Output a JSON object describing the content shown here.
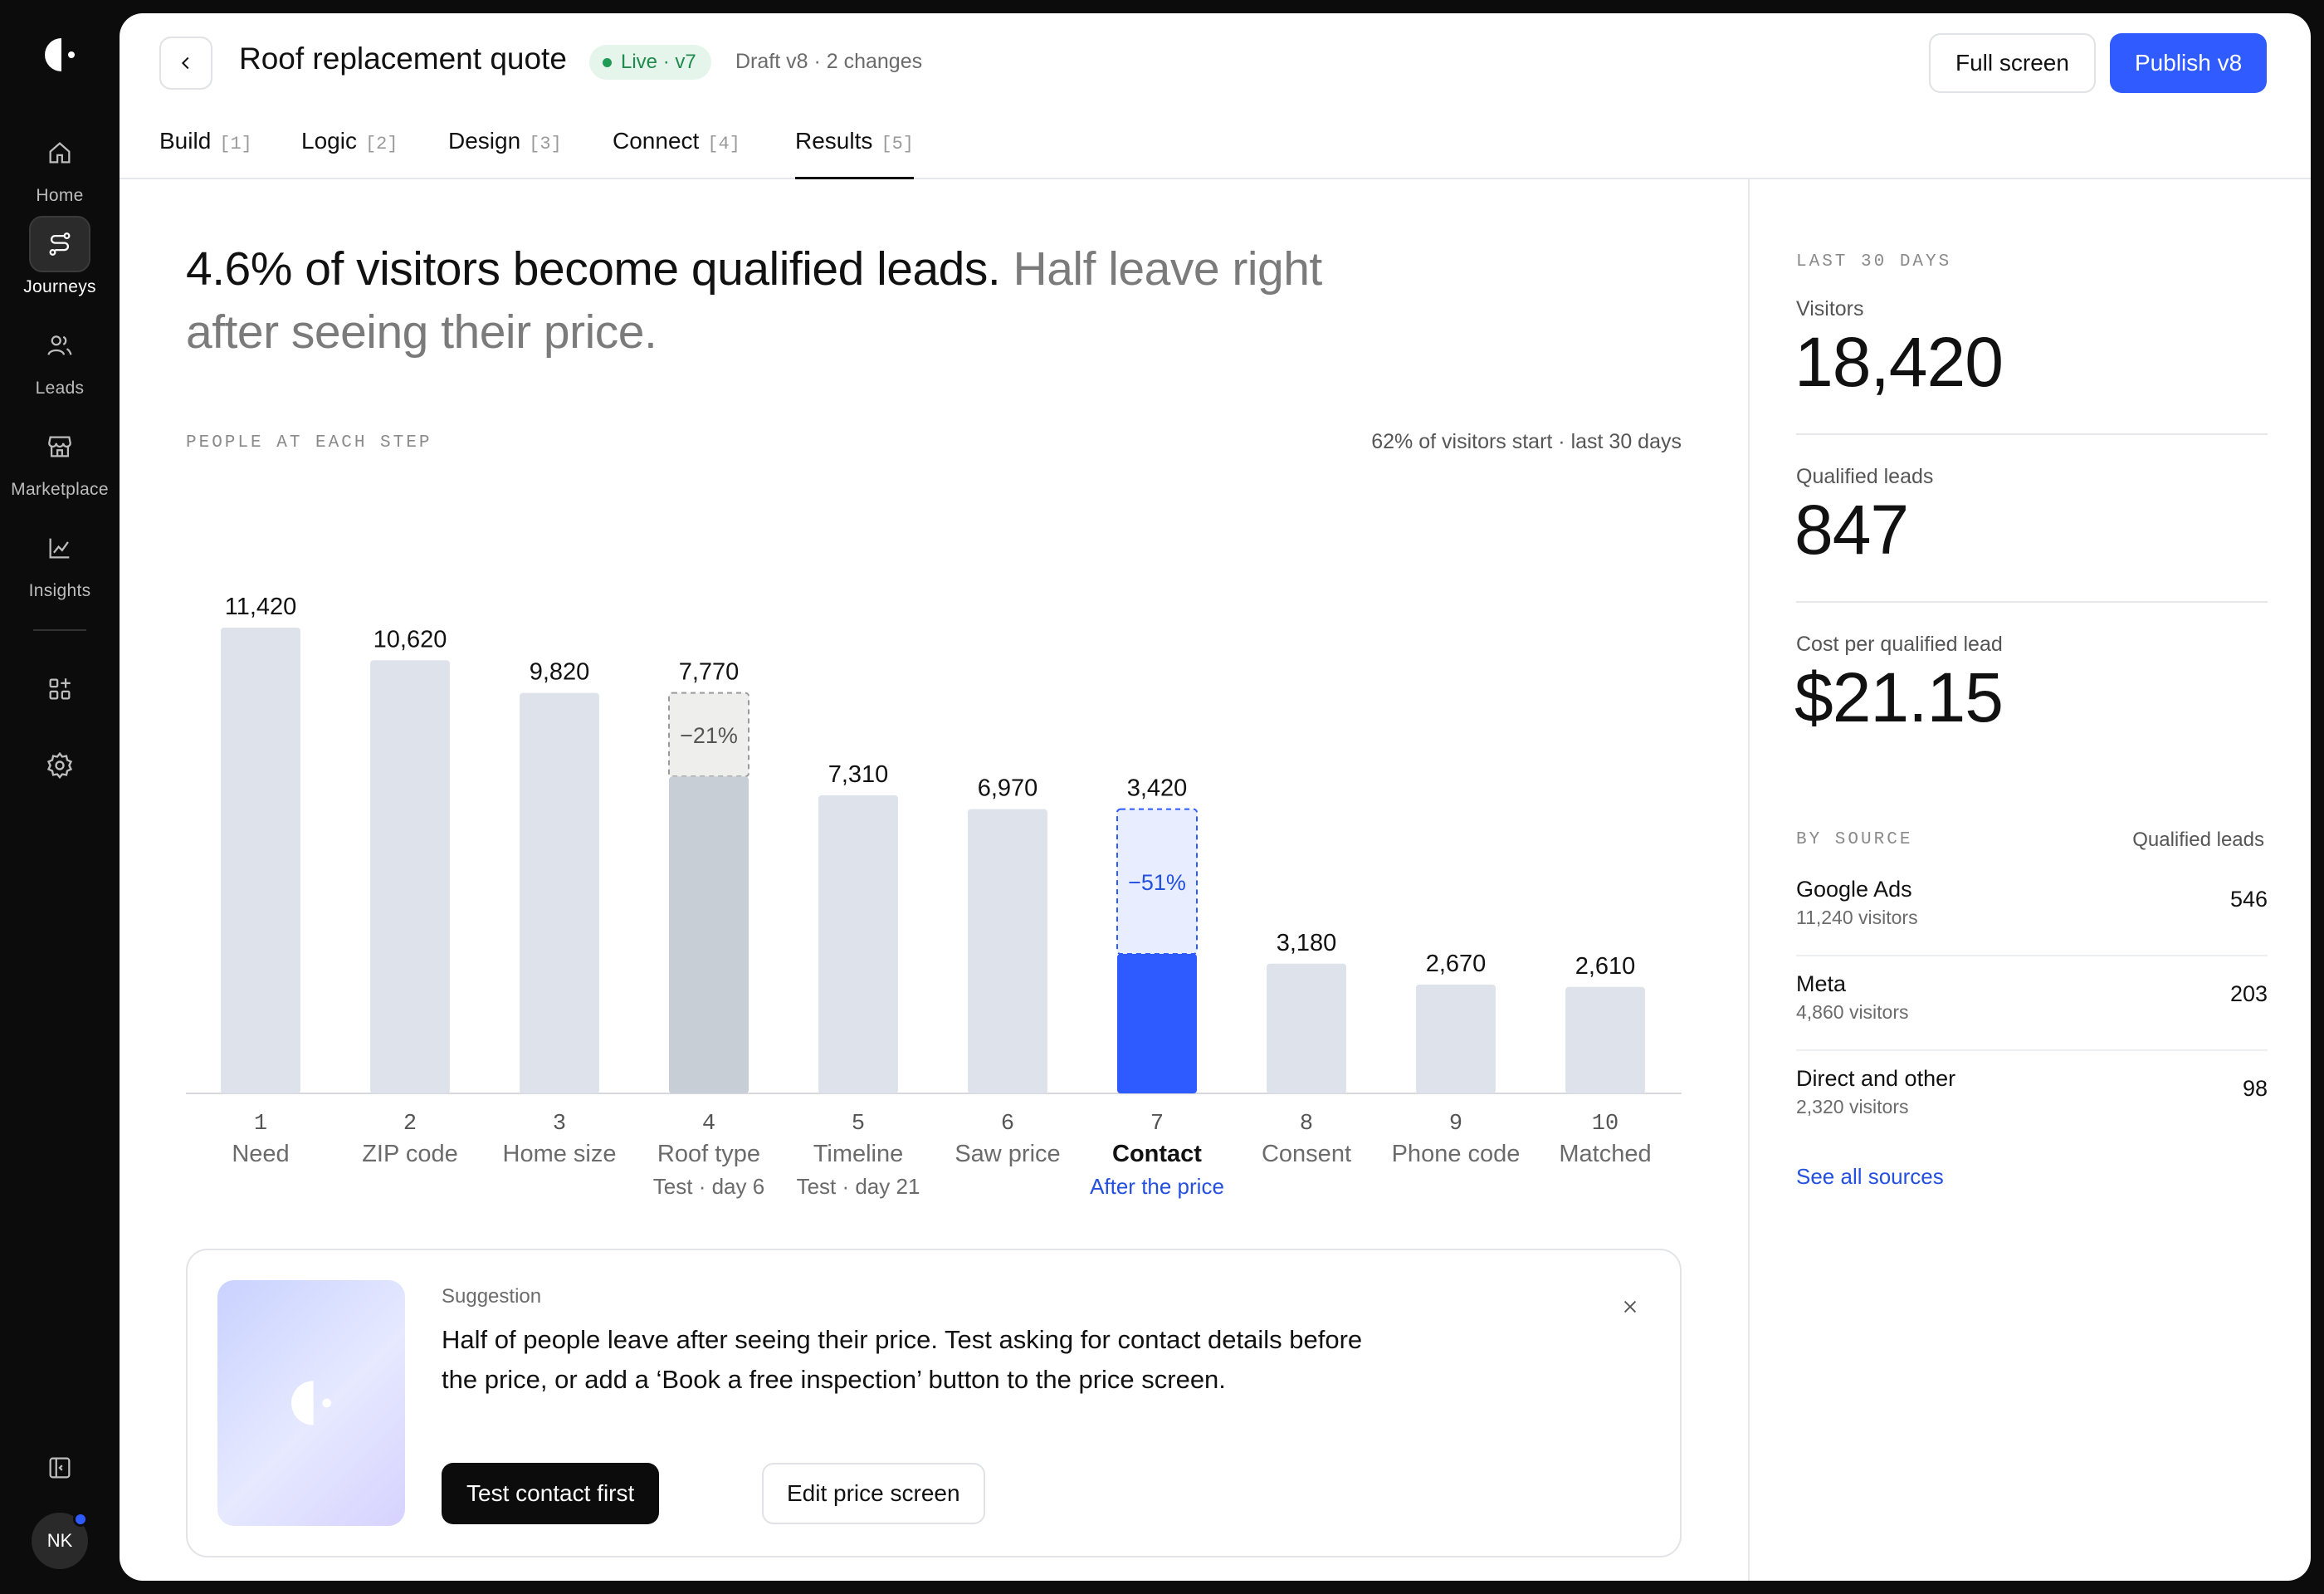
{
  "rail": {
    "items": [
      {
        "label": "Home",
        "icon": "home-icon"
      },
      {
        "label": "Journeys",
        "icon": "journeys-icon"
      },
      {
        "label": "Leads",
        "icon": "leads-icon"
      },
      {
        "label": "Marketplace",
        "icon": "marketplace-icon"
      },
      {
        "label": "Insights",
        "icon": "insights-icon"
      }
    ],
    "avatar_initials": "NK"
  },
  "header": {
    "title": "Roof replacement quote",
    "live_badge": "Live · v7",
    "draft_text": "Draft v8 · 2 changes",
    "fullscreen_label": "Full screen",
    "publish_label": "Publish v8"
  },
  "tabs": [
    {
      "label": "Build",
      "num": "[1]"
    },
    {
      "label": "Logic",
      "num": "[2]"
    },
    {
      "label": "Design",
      "num": "[3]"
    },
    {
      "label": "Connect",
      "num": "[4]"
    },
    {
      "label": "Results",
      "num": "[5]"
    }
  ],
  "headline": {
    "strong": "4.6% of visitors become qualified leads.",
    "muted": "Half leave right after seeing their price."
  },
  "chart_section": {
    "label": "PEOPLE AT EACH STEP",
    "meta": "62% of visitors start · last 30 days"
  },
  "chart_data": {
    "type": "bar",
    "categories": [
      "Need",
      "ZIP code",
      "Home size",
      "Roof type",
      "Timeline",
      "Saw price",
      "Contact",
      "Consent",
      "Phone code",
      "Matched"
    ],
    "step_numbers": [
      "1",
      "2",
      "3",
      "4",
      "5",
      "6",
      "7",
      "8",
      "9",
      "10"
    ],
    "sublabels": [
      "",
      "",
      "",
      "Test · day 6",
      "Test · day 21",
      "",
      "After the price",
      "",
      "",
      ""
    ],
    "values": [
      11420,
      10620,
      9820,
      7770,
      7310,
      6970,
      3420,
      3180,
      2670,
      2610
    ],
    "value_labels": [
      "11,420",
      "10,620",
      "9,820",
      "7,770",
      "7,310",
      "6,970",
      "3,420",
      "3,180",
      "2,670",
      "2,610"
    ],
    "drops": [
      {
        "index": 3,
        "label": "−21%"
      },
      {
        "index": 6,
        "label": "−51%"
      }
    ],
    "highlight_index": 6,
    "ylim": [
      0,
      11420
    ],
    "colors": {
      "bar": "#dee2ea",
      "bar_mid": "#c8ced6",
      "highlight": "#2e5bff",
      "drop_fill_gray": "#eeeeec",
      "drop_fill_blue": "#e8eeff"
    }
  },
  "suggestion": {
    "label": "Suggestion",
    "body": "Half of people leave after seeing their price. Test asking for contact details before the price, or add a ‘Book a free inspection’ button to the price screen.",
    "primary_label": "Test contact first",
    "secondary_label": "Edit price screen"
  },
  "stats": {
    "period_label": "LAST 30 DAYS",
    "visitors_label": "Visitors",
    "visitors_value": "18,420",
    "leads_label": "Qualified leads",
    "leads_value": "847",
    "cpl_label": "Cost per qualified lead",
    "cpl_value": "$21.15",
    "source_label": "BY SOURCE",
    "source_col": "Qualified leads",
    "sources": [
      {
        "name": "Google Ads",
        "visitors": "11,240 visitors",
        "value": "546"
      },
      {
        "name": "Meta",
        "visitors": "4,860 visitors",
        "value": "203"
      },
      {
        "name": "Direct and other",
        "visitors": "2,320 visitors",
        "value": "98"
      }
    ],
    "see_all": "See all sources"
  }
}
